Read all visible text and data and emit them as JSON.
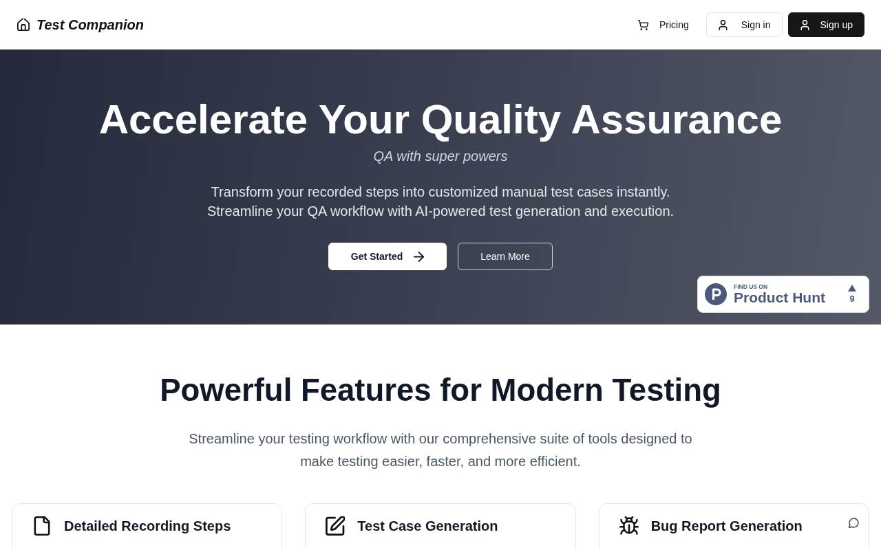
{
  "header": {
    "brand": "Test Companion",
    "nav": [
      {
        "label": "Pricing",
        "kind": "link"
      },
      {
        "label": "Sign in",
        "kind": "outline"
      },
      {
        "label": "Sign up",
        "kind": "primary"
      }
    ]
  },
  "hero": {
    "title": "Accelerate Your Quality Assurance",
    "tagline": "QA with super powers",
    "description": "Transform your recorded steps into customized manual test cases instantly. Streamline your QA workflow with AI-powered test generation and execution.",
    "actions": [
      {
        "label": "Get Started",
        "kind": "primary"
      },
      {
        "label": "Learn More",
        "kind": "outline"
      }
    ],
    "product_hunt_badge": {
      "caption": "FIND US ON",
      "name": "Product Hunt",
      "votes": "9"
    }
  },
  "features": {
    "title": "Powerful Features for Modern Testing",
    "description": "Streamline your testing workflow with our comprehensive suite of tools designed to make testing easier, faster, and more efficient.",
    "cards": [
      {
        "title": "Detailed Recording Steps"
      },
      {
        "title": "Test Case Generation"
      },
      {
        "title": "Bug Report Generation"
      }
    ]
  }
}
